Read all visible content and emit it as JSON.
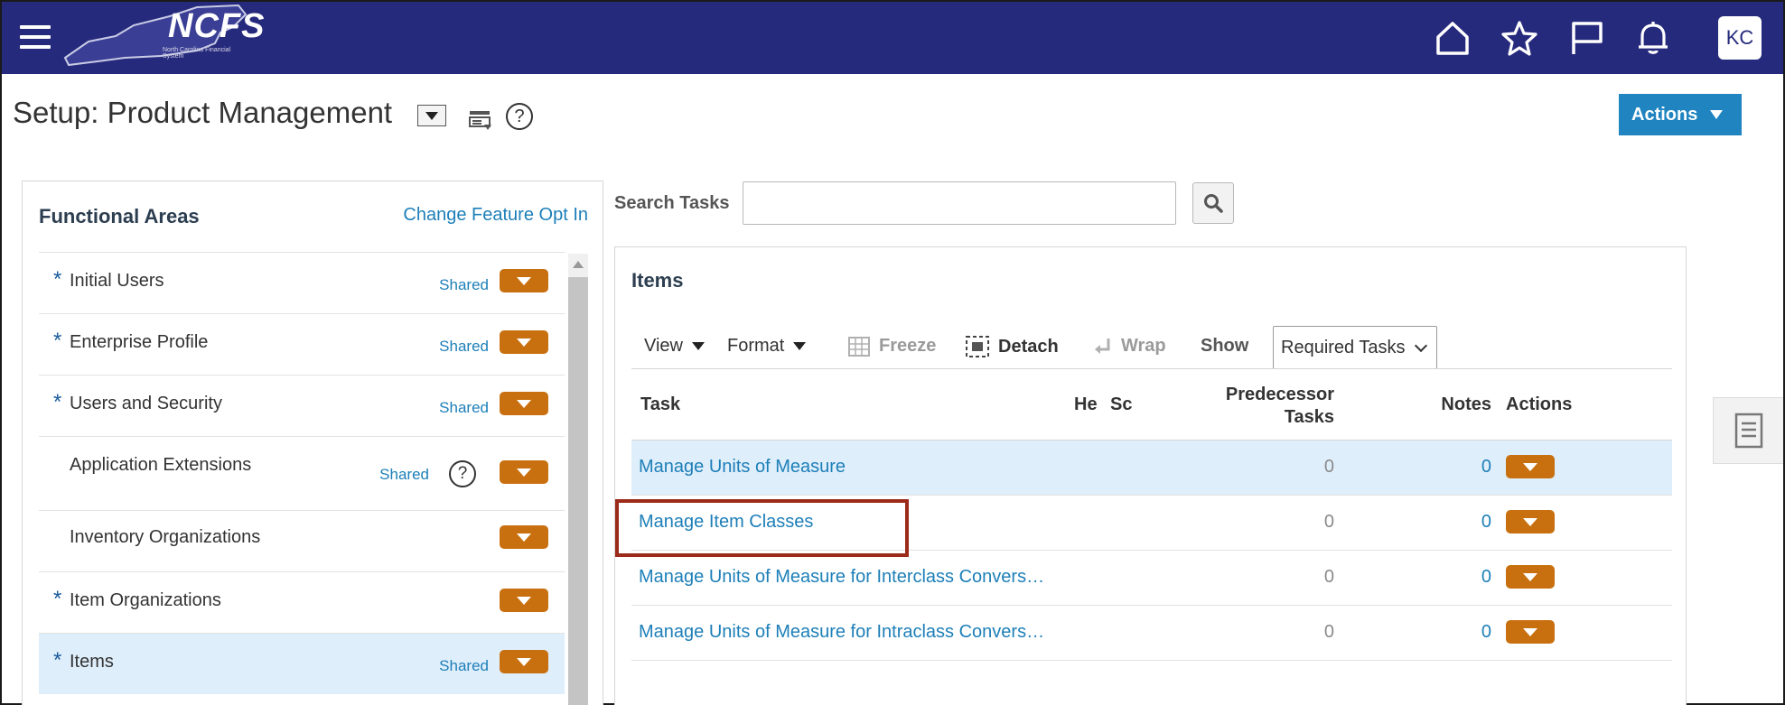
{
  "header": {
    "logo_text": "NCFS",
    "logo_subtext": "North Carolina Financial System",
    "icons": [
      "home-icon",
      "favorites-star-icon",
      "flag-icon",
      "notifications-bell-icon"
    ],
    "user_initials": "KC",
    "brand_color": "#262a7c"
  },
  "page": {
    "title": "Setup: Product Management",
    "actions_label": "Actions",
    "accent_color": "#1f84c0"
  },
  "functional_areas": {
    "title": "Functional Areas",
    "change_link": "Change Feature Opt In",
    "items": [
      {
        "label": "Initial Users",
        "required": "*",
        "shared": "Shared"
      },
      {
        "label": "Enterprise Profile",
        "required": "*",
        "shared": "Shared"
      },
      {
        "label": "Users and Security",
        "required": "*",
        "shared": "Shared"
      },
      {
        "label": "Application Extensions",
        "required": "",
        "shared": "Shared",
        "help": "?"
      },
      {
        "label": "Inventory Organizations",
        "required": "",
        "shared": ""
      },
      {
        "label": "Item Organizations",
        "required": "*",
        "shared": ""
      },
      {
        "label": "Items",
        "required": "*",
        "shared": "Shared",
        "selected": true
      }
    ]
  },
  "search": {
    "label": "Search Tasks",
    "value": "",
    "placeholder": ""
  },
  "items_panel": {
    "title": "Items",
    "toolbar": {
      "view": "View",
      "format": "Format",
      "freeze": "Freeze",
      "detach": "Detach",
      "wrap": "Wrap",
      "show": "Show",
      "show_value": "Required Tasks"
    },
    "columns": {
      "task": "Task",
      "he": "He",
      "sc": "Sc",
      "predecessor_line1": "Predecessor",
      "predecessor_line2": "Tasks",
      "notes": "Notes",
      "actions": "Actions"
    },
    "rows": [
      {
        "task": "Manage Units of Measure",
        "predecessor": "0",
        "notes": "0",
        "selected": true
      },
      {
        "task": "Manage Item Classes",
        "predecessor": "0",
        "notes": "0",
        "highlighted": true
      },
      {
        "task": "Manage Units of Measure for Interclass Convers…",
        "predecessor": "0",
        "notes": "0"
      },
      {
        "task": "Manage Units of Measure for Intraclass Convers…",
        "predecessor": "0",
        "notes": "0"
      }
    ]
  },
  "colors": {
    "link": "#1d7fb8",
    "row_dropdown": "#c8700f",
    "highlight_box": "#9c2a1a",
    "selected_row": "#dfeefb"
  }
}
